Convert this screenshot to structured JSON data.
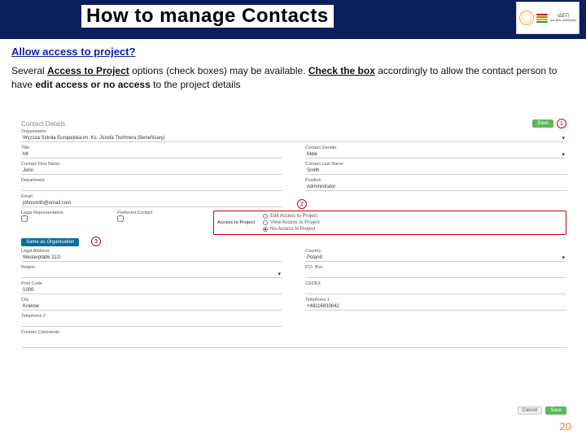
{
  "header": {
    "title": "How to manage Contacts",
    "logo_text_top": "ΙΔΕΠ",
    "logo_text_bottom": "Διά Βίου Μάθησης"
  },
  "intro": {
    "question": "Allow access to project?",
    "explain_html": "Several Access to Project options (check boxes) may be available. Check the box accordingly to allow the contact person to have edit access or no access to the project details"
  },
  "form": {
    "section": "Contact Details",
    "btn_save": "Save",
    "organisation": {
      "label": "Organisation",
      "value": "Wyzsza Szkola Europejska im. Ks. Józefa Tischnera (Beneficiary)"
    },
    "title": {
      "label": "Title",
      "value": "Mr"
    },
    "gender": {
      "label": "Contact Gender",
      "value": "Male"
    },
    "first_name": {
      "label": "Contact First Name",
      "value": "John"
    },
    "last_name": {
      "label": "Contact Last Name",
      "value": "Smith"
    },
    "department": {
      "label": "Department",
      "value": ""
    },
    "position": {
      "label": "Position",
      "value": "Administrator"
    },
    "email": {
      "label": "Email",
      "value": "johnsmith@email.com"
    },
    "legal_rep": {
      "label": "Legal Representative"
    },
    "pref_contact": {
      "label": "Preferred Contact"
    },
    "access": {
      "label": "Access to Project",
      "options": [
        "Edit Access to Project",
        "View Access to Project",
        "No Access to Project"
      ]
    },
    "same_org": "Same as Organisation",
    "legal_addr": {
      "label": "Legal Address",
      "value": "Westerplatte 11/2"
    },
    "country": {
      "label": "Country",
      "value": "Poland"
    },
    "region": {
      "label": "Region",
      "value": ""
    },
    "pobox": {
      "label": "P.O. Box",
      "value": ""
    },
    "postcode": {
      "label": "Post Code",
      "value": "1000"
    },
    "cedex": {
      "label": "CEDEX",
      "value": ""
    },
    "city": {
      "label": "City",
      "value": "Kraków"
    },
    "tel1": {
      "label": "Telephone 1",
      "value": "+48116833642"
    },
    "tel2": {
      "label": "Telephone 2",
      "value": ""
    },
    "comments": {
      "label": "Contact Comments",
      "value": ""
    },
    "cancel": "Cancel",
    "save2": "Save"
  },
  "callouts": {
    "one": "1",
    "two": "2",
    "three": "3"
  },
  "page_number": "20"
}
